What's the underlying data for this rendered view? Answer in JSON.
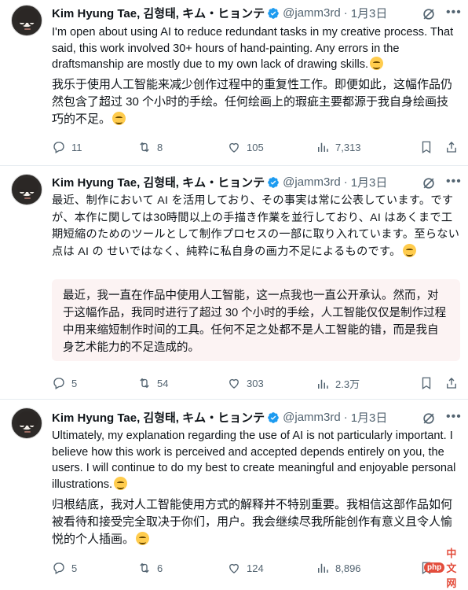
{
  "author": {
    "name": "Kim Hyung Tae, 김형태, キム・ヒョンテ",
    "handle": "@jamm3rd",
    "separator": "·",
    "date": "1月3日"
  },
  "icons": {
    "verified": "verified-badge-icon",
    "grok": "grok-icon",
    "more": "more-icon"
  },
  "colors": {
    "verified_blue": "#1d9bf0",
    "secondary_text": "#536471",
    "quote_bg": "#fcf3f3"
  },
  "tweets": [
    {
      "body": "I'm open about using AI to reduce redundant tasks in my creative process. That said, this work involved 30+ hours of hand-painting. Any errors in the draftsmanship are mostly due to my own lack of drawing skills.",
      "translation": "我乐于使用人工智能来减少创作过程中的重复性工作。即便如此，这幅作品仍然包含了超过 30 个小时的手绘。任何绘画上的瑕疵主要都源于我自身绘画技巧的不足。",
      "stats": {
        "replies": "11",
        "reposts": "8",
        "likes": "105",
        "views": "7,313"
      }
    },
    {
      "body": "最近、制作において AI を活用しており、その事実は常に公表しています。ですが、本作に関しては30時間以上の手描き作業を並行しており、AI はあくまで工期短縮のためのツールとして制作プロセスの一部に取り入れています。至らない点は AI の せいではなく、純粋に私自身の画力不足によるものです。",
      "translation": "最近，我一直在作品中使用人工智能，这一点我也一直公开承认。然而，对于这幅作品，我同时进行了超过 30 个小时的手绘，人工智能仅仅是制作过程中用来缩短制作时间的工具。任何不足之处都不是人工智能的错，而是我自身艺术能力的不足造成的。",
      "stats": {
        "replies": "5",
        "reposts": "54",
        "likes": "303",
        "views": "2.3万"
      }
    },
    {
      "body": "Ultimately, my explanation regarding the use of AI is not particularly important. I believe how this work is perceived and accepted depends entirely on you, the users. I will continue to do my best to create meaningful and enjoyable personal illustrations.",
      "translation": "归根结底，我对人工智能使用方式的解释并不特别重要。我相信这部作品如何被看待和接受完全取决于你们，用户。我会继续尽我所能创作有意义且令人愉悦的个人插画。",
      "stats": {
        "replies": "5",
        "reposts": "6",
        "likes": "124",
        "views": "8,896"
      }
    }
  ],
  "watermark": {
    "logo": "php",
    "text": "中文网"
  }
}
